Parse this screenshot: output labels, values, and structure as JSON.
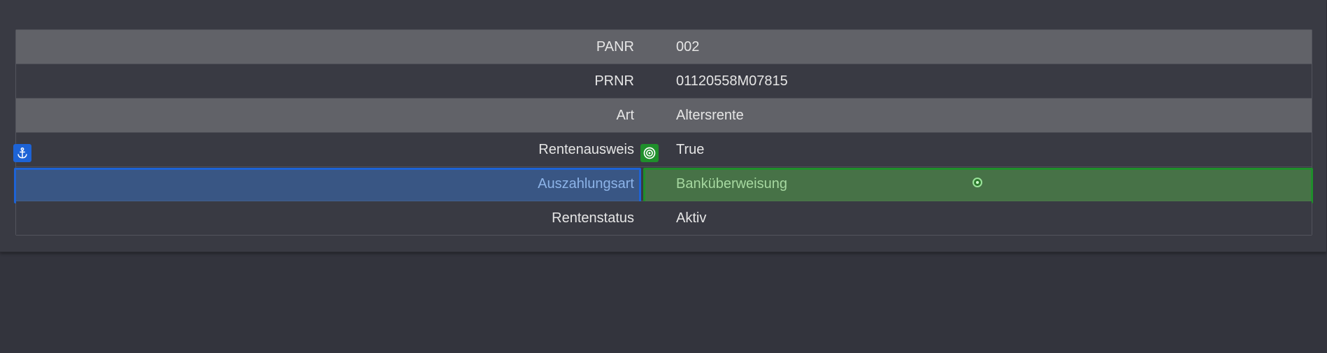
{
  "rows": [
    {
      "label": "PANR",
      "value": "002"
    },
    {
      "label": "PRNR",
      "value": "01120558M07815"
    },
    {
      "label": "Art",
      "value": "Altersrente"
    },
    {
      "label": "Rentenausweis",
      "value": "True"
    },
    {
      "label": "Auszahlungsart",
      "value": "Banküberweisung"
    },
    {
      "label": "Rentenstatus",
      "value": "Aktiv"
    }
  ],
  "overlay": {
    "anchor_icon": "anchor-icon",
    "target_icon": "target-icon",
    "drop_point_icon": "drop-point-icon",
    "label_highlight_color": "#1d63d6",
    "value_highlight_color": "#1f8f2b"
  },
  "colors": {
    "background": "#33343d",
    "alt_row": "#616268",
    "text": "#e6e6e6"
  }
}
